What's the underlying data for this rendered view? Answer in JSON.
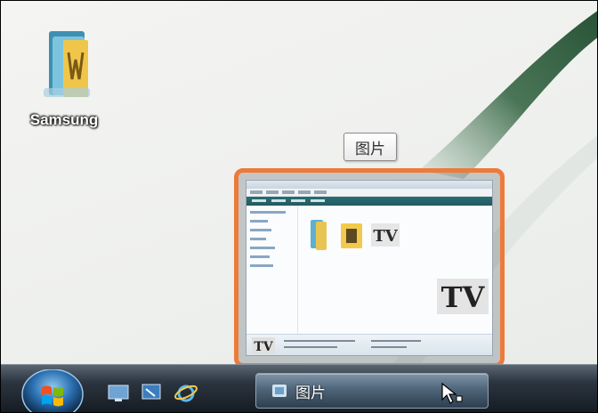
{
  "desktop": {
    "icons": [
      {
        "name": "Samsung",
        "icon": "folder-icon"
      }
    ]
  },
  "taskbar": {
    "start_button": {
      "icon": "windows-logo-icon"
    },
    "quick_launch": [
      {
        "icon": "show-desktop-icon"
      },
      {
        "icon": "switch-windows-icon"
      },
      {
        "icon": "internet-explorer-icon"
      }
    ],
    "buttons": [
      {
        "label": "图片",
        "icon": "pictures-folder-icon",
        "active": true
      }
    ]
  },
  "preview": {
    "tooltip": "图片",
    "highlight_color": "#ee7a3a"
  },
  "colors": {
    "accent": "#ee7a3a",
    "swoosh": "#2d5a3a",
    "taskbar": "#1e2630"
  }
}
